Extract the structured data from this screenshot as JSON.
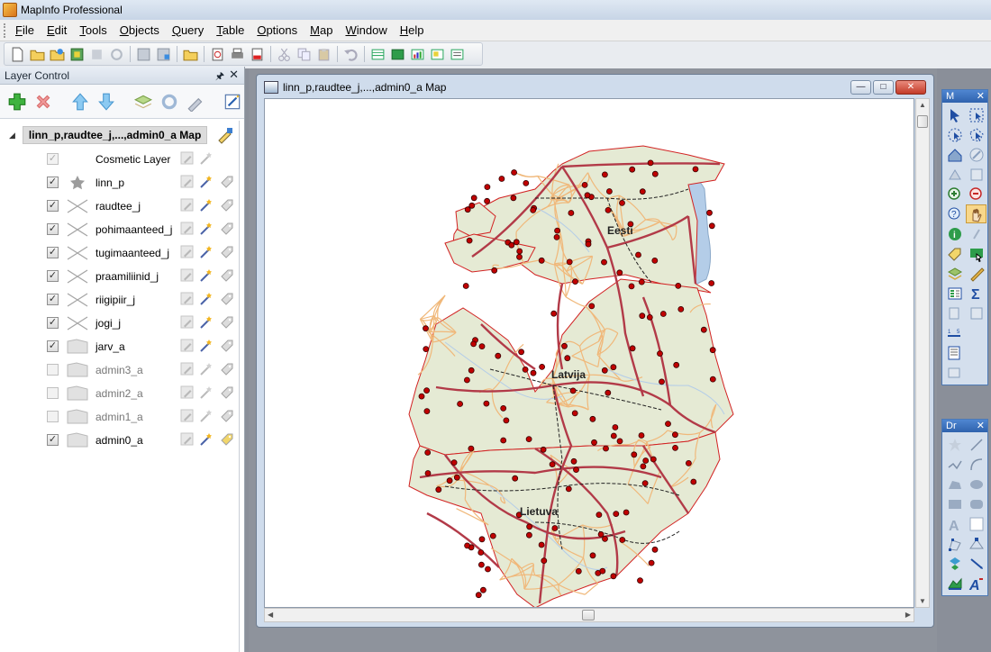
{
  "app": {
    "title": "MapInfo Professional"
  },
  "menubar": {
    "items": [
      "File",
      "Edit",
      "Tools",
      "Objects",
      "Query",
      "Table",
      "Options",
      "Map",
      "Window",
      "Help"
    ]
  },
  "layer_control": {
    "title": "Layer Control",
    "map_name": "linn_p,raudtee_j,...,admin0_a Map",
    "layers": [
      {
        "name": "Cosmetic Layer",
        "checked": true,
        "enabled": false,
        "icon": "none"
      },
      {
        "name": "linn_p",
        "checked": true,
        "enabled": true,
        "icon": "star"
      },
      {
        "name": "raudtee_j",
        "checked": true,
        "enabled": true,
        "icon": "line"
      },
      {
        "name": "pohimaanteed_j",
        "checked": true,
        "enabled": true,
        "icon": "line"
      },
      {
        "name": "tugimaanteed_j",
        "checked": true,
        "enabled": true,
        "icon": "line"
      },
      {
        "name": "praamiliinid_j",
        "checked": true,
        "enabled": true,
        "icon": "line"
      },
      {
        "name": "riigipiir_j",
        "checked": true,
        "enabled": true,
        "icon": "line"
      },
      {
        "name": "jogi_j",
        "checked": true,
        "enabled": true,
        "icon": "line"
      },
      {
        "name": "jarv_a",
        "checked": true,
        "enabled": true,
        "icon": "region"
      },
      {
        "name": "admin3_a",
        "checked": false,
        "enabled": false,
        "icon": "region"
      },
      {
        "name": "admin2_a",
        "checked": false,
        "enabled": false,
        "icon": "region"
      },
      {
        "name": "admin1_a",
        "checked": false,
        "enabled": false,
        "icon": "region"
      },
      {
        "name": "admin0_a",
        "checked": true,
        "enabled": true,
        "icon": "region"
      }
    ]
  },
  "map_window": {
    "title": "linn_p,raudtee_j,...,admin0_a Map",
    "labels": {
      "estonia": "Eesti",
      "latvia": "Latvija",
      "lithuania": "Lietuva"
    }
  },
  "palettes": {
    "main": {
      "title": "M"
    },
    "drawing": {
      "title": "Dr"
    }
  },
  "colors": {
    "country_fill": "#e5ead4",
    "country_border": "#d22222",
    "highway": "#b23a48",
    "secondary_road": "#f0b87a",
    "railway": "#222222",
    "water": "#b4cde8",
    "city": "#c00000"
  }
}
